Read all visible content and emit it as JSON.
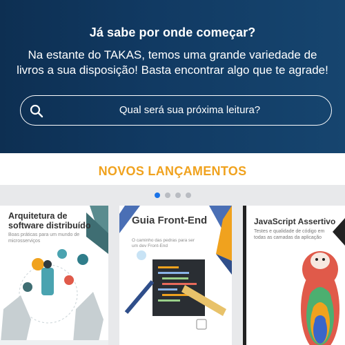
{
  "hero": {
    "title": "Já sabe por onde começar?",
    "subtitle": "Na estante do TAKAS, temos uma grande variedade de livros a sua disposição! Basta encontrar algo que te agrade!",
    "search": {
      "placeholder": "Qual será sua próxima leitura?",
      "icon": "search-icon"
    }
  },
  "section": {
    "title": "NOVOS LANÇAMENTOS"
  },
  "carousel": {
    "active_index": 0,
    "dots": 4,
    "books": [
      {
        "title": "Arquitetura de software distribuído",
        "subtitle": "Boas práticas para um mundo de microsserviços"
      },
      {
        "title": "Guia Front-End",
        "subtitle": "O caminho das pedras para ser um dev Front-End"
      },
      {
        "title": "JavaScript Assertivo",
        "subtitle": "Testes e qualidade de código em todas as camadas da aplicação"
      }
    ]
  },
  "colors": {
    "hero_bg": "#113a63",
    "accent": "#f0a21e",
    "active_dot": "#1a73e8"
  }
}
